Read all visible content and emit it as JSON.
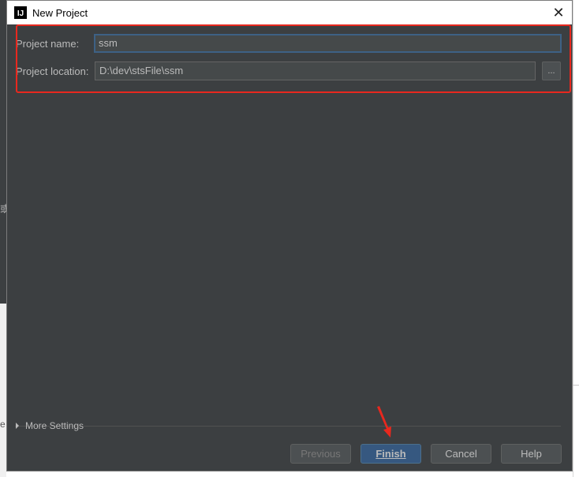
{
  "dialog": {
    "title": "New Project"
  },
  "form": {
    "name_label": "Project name:",
    "name_value": "ssm",
    "location_label": "Project location:",
    "location_value": "D:\\dev\\stsFile\\ssm",
    "browse_label": "..."
  },
  "more_settings": {
    "label": "More Settings"
  },
  "buttons": {
    "previous": "Previous",
    "finish": "Finish",
    "cancel": "Cancel",
    "help": "Help"
  },
  "background": {
    "glyph_1": "或",
    "glyph_2": "e"
  },
  "colors": {
    "dialog_bg": "#3c3f41",
    "highlight": "#e8281e",
    "finish_bg": "#365880"
  }
}
